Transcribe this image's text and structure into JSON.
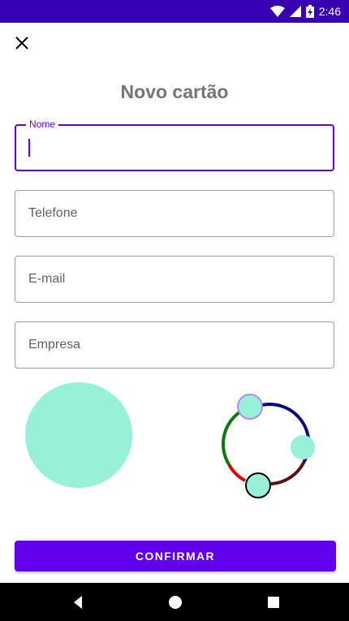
{
  "status_bar": {
    "time": "2:46",
    "background_color": "#3700b3",
    "icons": [
      "wifi-icon",
      "signal-icon",
      "battery-charging-icon"
    ]
  },
  "toolbar": {
    "close_icon": "close-icon"
  },
  "page": {
    "title": "Novo cartão"
  },
  "form": {
    "nome": {
      "label": "Nome",
      "value": ""
    },
    "telefone": {
      "placeholder": "Telefone",
      "value": ""
    },
    "email": {
      "placeholder": "E-mail",
      "value": ""
    },
    "empresa": {
      "placeholder": "Empresa",
      "value": ""
    }
  },
  "color_picker": {
    "preview_color": "#96f1d7",
    "handle_color": "#96f1d7"
  },
  "actions": {
    "confirm_label": "CONFIRMAR"
  },
  "colors": {
    "accent": "#6200ee",
    "accent_dark": "#3700b3"
  },
  "nav_bar": {
    "icons": [
      "back-icon",
      "home-icon",
      "recents-icon"
    ]
  }
}
